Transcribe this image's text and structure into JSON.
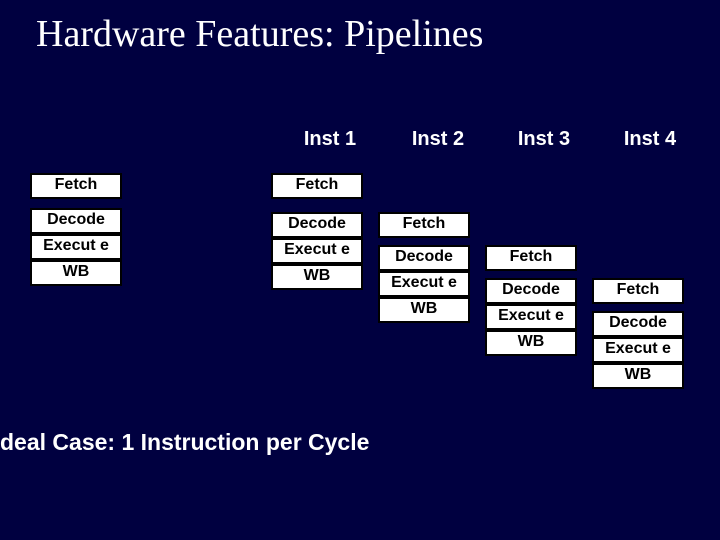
{
  "title": "Hardware Features: Pipelines",
  "legend": {
    "fetch": "Fetch",
    "decode": "Decode",
    "execute": "Execut e",
    "wb": "WB"
  },
  "columns": {
    "c1": "Inst 1",
    "c2": "Inst 2",
    "c3": "Inst 3",
    "c4": "Inst 4"
  },
  "stage": {
    "fetch": "Fetch",
    "decode": "Decode",
    "execute": "Execut e",
    "wb": "WB"
  },
  "caption": "deal Case: 1 Instruction per Cycle"
}
